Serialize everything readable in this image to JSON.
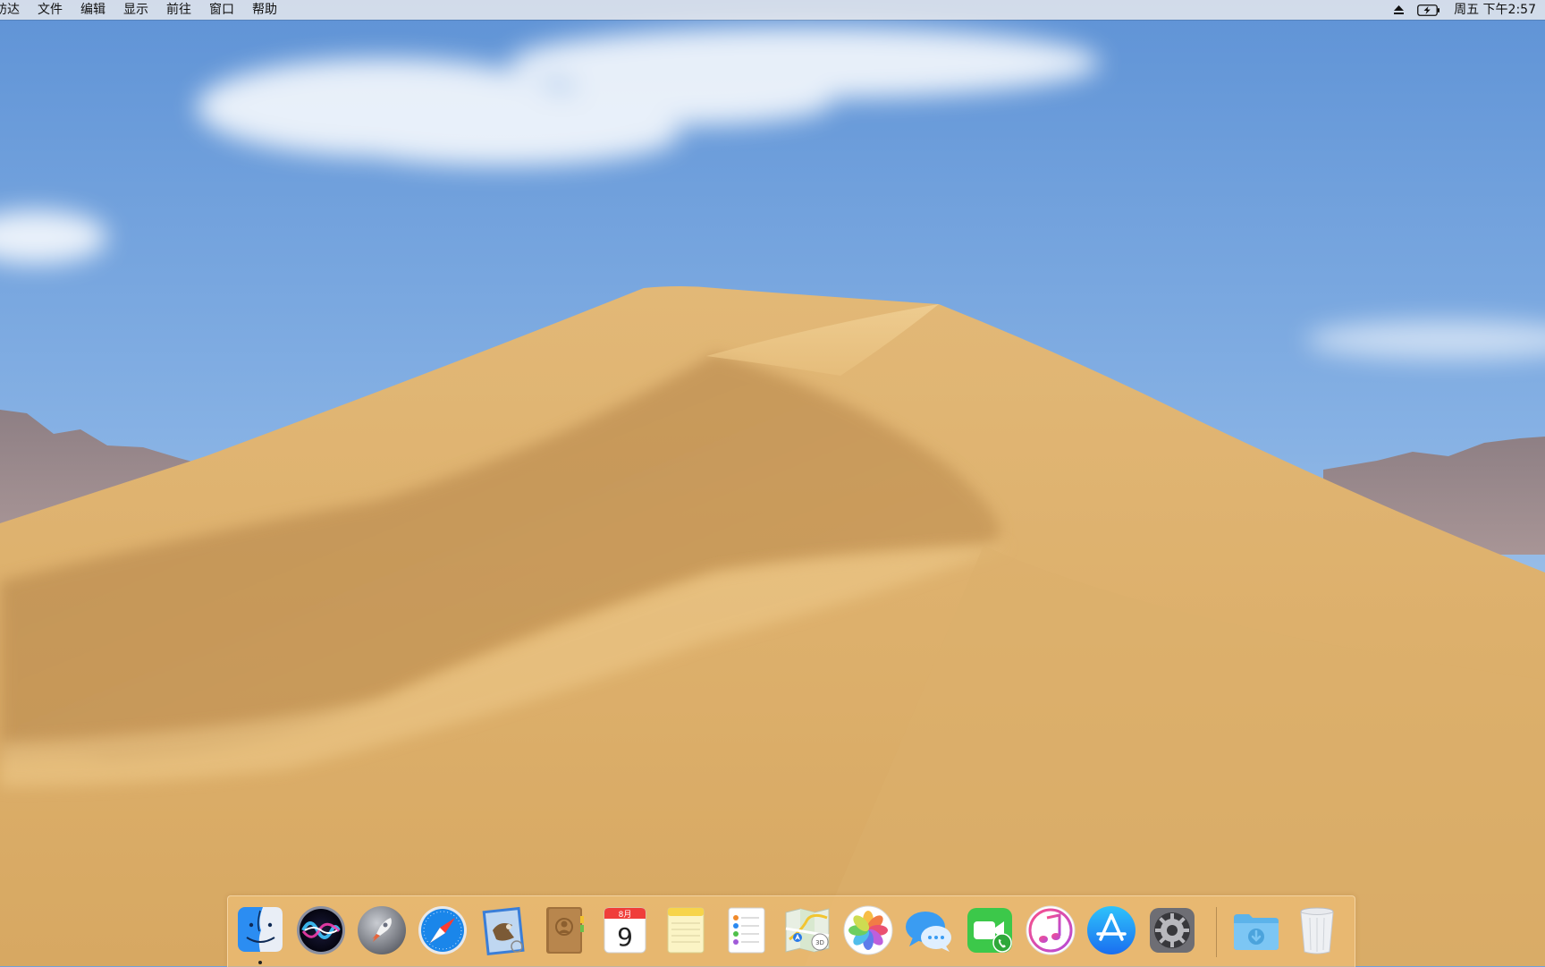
{
  "menubar": {
    "app_name": "訪达",
    "items": [
      "文件",
      "编辑",
      "显示",
      "前往",
      "窗口",
      "帮助"
    ],
    "status_icons": [
      "eject-icon",
      "battery-charging-icon"
    ],
    "clock": "周五 下午2:57"
  },
  "dock": {
    "apps": [
      {
        "name": "finder",
        "icon": "finder-icon",
        "running": true
      },
      {
        "name": "siri",
        "icon": "siri-icon",
        "running": false
      },
      {
        "name": "launchpad",
        "icon": "launchpad-icon",
        "running": false
      },
      {
        "name": "safari",
        "icon": "safari-icon",
        "running": false
      },
      {
        "name": "mail",
        "icon": "mail-icon",
        "running": false
      },
      {
        "name": "contacts",
        "icon": "contacts-icon",
        "running": false
      },
      {
        "name": "calendar",
        "icon": "calendar-icon",
        "running": false
      },
      {
        "name": "notes",
        "icon": "notes-icon",
        "running": false
      },
      {
        "name": "reminders",
        "icon": "reminders-icon",
        "running": false
      },
      {
        "name": "maps",
        "icon": "maps-icon",
        "running": false
      },
      {
        "name": "photos",
        "icon": "photos-icon",
        "running": false
      },
      {
        "name": "messages",
        "icon": "messages-icon",
        "running": false
      },
      {
        "name": "facetime",
        "icon": "facetime-icon",
        "running": false
      },
      {
        "name": "itunes",
        "icon": "itunes-icon",
        "running": false
      },
      {
        "name": "app-store",
        "icon": "app-store-icon",
        "running": false
      },
      {
        "name": "system-preferences",
        "icon": "system-preferences-icon",
        "running": false
      }
    ],
    "calendar": {
      "month": "8月",
      "day": "9"
    },
    "maps_badge": "3D",
    "stacks": [
      {
        "name": "downloads",
        "icon": "downloads-folder-icon"
      },
      {
        "name": "trash",
        "icon": "trash-icon"
      }
    ]
  }
}
